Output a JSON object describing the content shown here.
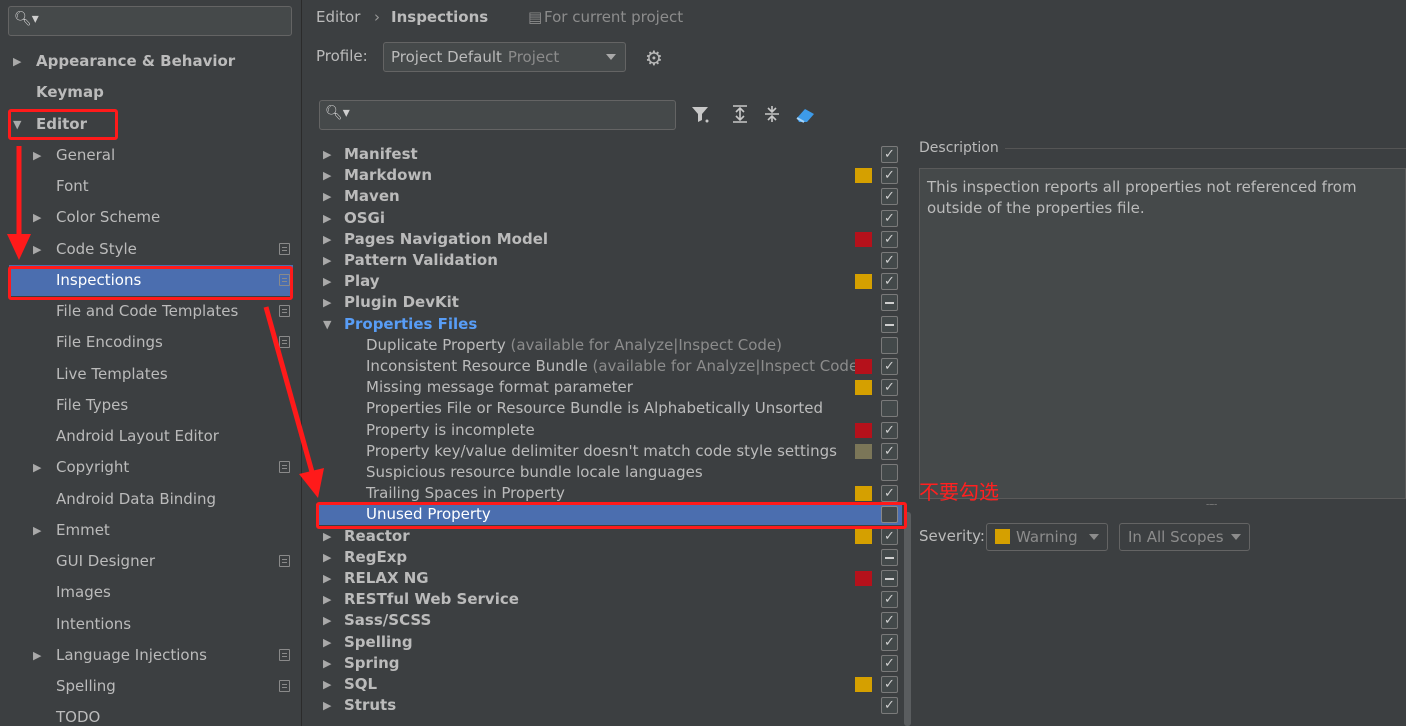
{
  "sidebar": {
    "search_placeholder": "",
    "items": [
      {
        "label": "Appearance & Behavior",
        "arrow": "▶",
        "bold": true,
        "project": false
      },
      {
        "label": "Keymap",
        "arrow": "",
        "bold": true,
        "project": false
      },
      {
        "label": "Editor",
        "arrow": "▼",
        "bold": true,
        "project": false
      },
      {
        "label": "General",
        "arrow": "▶",
        "bold": false,
        "project": false
      },
      {
        "label": "Font",
        "arrow": "",
        "bold": false,
        "project": false
      },
      {
        "label": "Color Scheme",
        "arrow": "▶",
        "bold": false,
        "project": false
      },
      {
        "label": "Code Style",
        "arrow": "▶",
        "bold": false,
        "project": true
      },
      {
        "label": "Inspections",
        "arrow": "",
        "bold": false,
        "project": true,
        "selected": true
      },
      {
        "label": "File and Code Templates",
        "arrow": "",
        "bold": false,
        "project": true
      },
      {
        "label": "File Encodings",
        "arrow": "",
        "bold": false,
        "project": true
      },
      {
        "label": "Live Templates",
        "arrow": "",
        "bold": false,
        "project": false
      },
      {
        "label": "File Types",
        "arrow": "",
        "bold": false,
        "project": false
      },
      {
        "label": "Android Layout Editor",
        "arrow": "",
        "bold": false,
        "project": false
      },
      {
        "label": "Copyright",
        "arrow": "▶",
        "bold": false,
        "project": true
      },
      {
        "label": "Android Data Binding",
        "arrow": "",
        "bold": false,
        "project": false
      },
      {
        "label": "Emmet",
        "arrow": "▶",
        "bold": false,
        "project": false
      },
      {
        "label": "GUI Designer",
        "arrow": "",
        "bold": false,
        "project": true
      },
      {
        "label": "Images",
        "arrow": "",
        "bold": false,
        "project": false
      },
      {
        "label": "Intentions",
        "arrow": "",
        "bold": false,
        "project": false
      },
      {
        "label": "Language Injections",
        "arrow": "▶",
        "bold": false,
        "project": true
      },
      {
        "label": "Spelling",
        "arrow": "",
        "bold": false,
        "project": true
      },
      {
        "label": "TODO",
        "arrow": "",
        "bold": false,
        "project": false
      }
    ]
  },
  "breadcrumb": {
    "editor": "Editor",
    "sep": "›",
    "page": "Inspections",
    "scope": "For current project"
  },
  "profile": {
    "label": "Profile:",
    "value": "Project Default",
    "scope": "Project"
  },
  "icons": {
    "gear": "gear-icon",
    "filter": "filter-icon",
    "expand": "expand-all-icon",
    "collapse": "collapse-all-icon",
    "reset": "eraser-icon"
  },
  "colors": {
    "error": "#b5111b",
    "warning": "#d5a000",
    "weak": "#7b7658",
    "accent": "#4b6eaf",
    "annotation": "#ff1a1a"
  },
  "inspections": [
    {
      "label": "Manifest",
      "arrow": "▶",
      "sev": "",
      "cb": "check",
      "level": 0
    },
    {
      "label": "Markdown",
      "arrow": "▶",
      "sev": "warning",
      "cb": "check",
      "level": 0
    },
    {
      "label": "Maven",
      "arrow": "▶",
      "sev": "",
      "cb": "check",
      "level": 0
    },
    {
      "label": "OSGi",
      "arrow": "▶",
      "sev": "",
      "cb": "check",
      "level": 0
    },
    {
      "label": "Pages Navigation Model",
      "arrow": "▶",
      "sev": "error",
      "cb": "check",
      "level": 0
    },
    {
      "label": "Pattern Validation",
      "arrow": "▶",
      "sev": "",
      "cb": "check",
      "level": 0
    },
    {
      "label": "Play",
      "arrow": "▶",
      "sev": "warning",
      "cb": "check",
      "level": 0
    },
    {
      "label": "Plugin DevKit",
      "arrow": "▶",
      "sev": "",
      "cb": "mixed",
      "level": 0
    },
    {
      "label": "Properties Files",
      "arrow": "▼",
      "sev": "",
      "cb": "mixed",
      "level": 0,
      "highlight": true
    },
    {
      "label": "Duplicate Property",
      "hint": "(available for Analyze|Inspect Code)",
      "arrow": "",
      "sev": "",
      "cb": "none",
      "level": 1
    },
    {
      "label": "Inconsistent Resource Bundle",
      "hint": "(available for Analyze|Inspect Code)",
      "arrow": "",
      "sev": "error",
      "cb": "check",
      "level": 1
    },
    {
      "label": "Missing message format parameter",
      "arrow": "",
      "sev": "warning",
      "cb": "check",
      "level": 1
    },
    {
      "label": "Properties File or Resource Bundle is Alphabetically Unsorted",
      "arrow": "",
      "sev": "",
      "cb": "none",
      "level": 1
    },
    {
      "label": "Property is incomplete",
      "arrow": "",
      "sev": "error",
      "cb": "check",
      "level": 1
    },
    {
      "label": "Property key/value delimiter doesn't match code style settings",
      "arrow": "",
      "sev": "weak",
      "cb": "check",
      "level": 1
    },
    {
      "label": "Suspicious resource bundle locale languages",
      "arrow": "",
      "sev": "",
      "cb": "none",
      "level": 1
    },
    {
      "label": "Trailing Spaces in Property",
      "arrow": "",
      "sev": "warning",
      "cb": "check",
      "level": 1
    },
    {
      "label": "Unused Property",
      "arrow": "",
      "sev": "",
      "cb": "none",
      "level": 1,
      "selected": true
    },
    {
      "label": "Reactor",
      "arrow": "▶",
      "sev": "warning",
      "cb": "check",
      "level": 0
    },
    {
      "label": "RegExp",
      "arrow": "▶",
      "sev": "",
      "cb": "mixed",
      "level": 0
    },
    {
      "label": "RELAX NG",
      "arrow": "▶",
      "sev": "error",
      "cb": "mixed",
      "level": 0
    },
    {
      "label": "RESTful Web Service",
      "arrow": "▶",
      "sev": "",
      "cb": "check",
      "level": 0
    },
    {
      "label": "Sass/SCSS",
      "arrow": "▶",
      "sev": "",
      "cb": "check",
      "level": 0
    },
    {
      "label": "Spelling",
      "arrow": "▶",
      "sev": "",
      "cb": "check",
      "level": 0
    },
    {
      "label": "Spring",
      "arrow": "▶",
      "sev": "",
      "cb": "check",
      "level": 0
    },
    {
      "label": "SQL",
      "arrow": "▶",
      "sev": "warning",
      "cb": "check",
      "level": 0
    },
    {
      "label": "Struts",
      "arrow": "▶",
      "sev": "",
      "cb": "check",
      "level": 0
    }
  ],
  "description": {
    "label": "Description",
    "text": "This inspection reports all properties not referenced from outside of the properties file."
  },
  "severity": {
    "label": "Severity:",
    "value": "Warning",
    "scope": "In All Scopes"
  },
  "annotation": {
    "note": "不要勾选"
  }
}
